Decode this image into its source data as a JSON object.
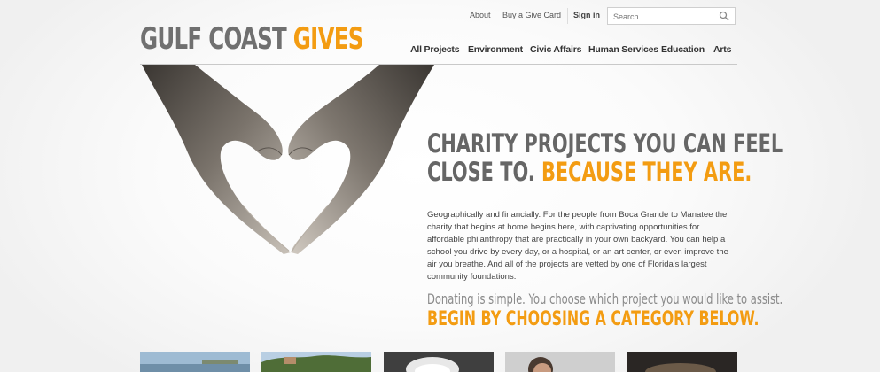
{
  "logo": {
    "part1": "GULF COAST ",
    "part2": "GIVES"
  },
  "utility_nav": {
    "about": "About",
    "buy_card": "Buy a Give Card",
    "sign_in": "Sign in"
  },
  "search": {
    "placeholder": "Search"
  },
  "main_nav": [
    "All Projects",
    "Environment",
    "Civic Affairs",
    "Human Services",
    "Education",
    "Arts"
  ],
  "hero": {
    "headline_line1": "CHARITY PROJECTS YOU CAN FEEL",
    "headline_line2": "CLOSE TO. ",
    "headline_accent": "BECAUSE THEY ARE.",
    "body": "Geographically and financially. For the people from Boca Grande to Manatee the charity that begins at home begins here, with captivating opportunities for affordable philanthropy that are practically in your own backyard. You can help a school you drive by every day, or a hospital, or an art center, or even improve the air you breathe. And all of the projects are vetted by one of Florida's largest community foundations.",
    "subline": "Donating is simple. You choose which project you would like to assist.",
    "cta": "BEGIN BY CHOOSING A CATEGORY BELOW."
  },
  "colors": {
    "accent": "#f39c12",
    "logo_gray": "#707070",
    "headline_gray": "#666666"
  },
  "icons": {
    "search": "search-icon"
  }
}
